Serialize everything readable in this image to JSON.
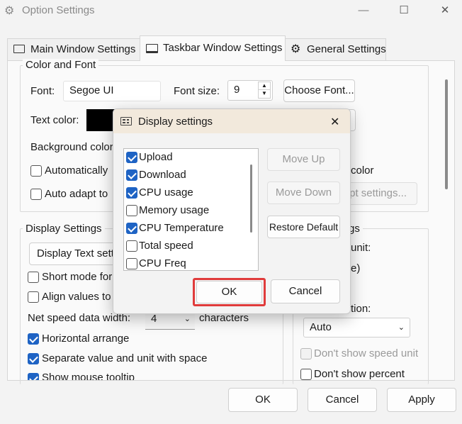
{
  "window": {
    "title": "Option Settings",
    "icon": "gear-icon",
    "minimize": "—",
    "maximize": "☐",
    "close": "✕"
  },
  "tabs": [
    {
      "label": "Main Window Settings",
      "icon": "monitor-icon"
    },
    {
      "label": "Taskbar Window Settings",
      "icon": "taskbar-icon",
      "active": true
    },
    {
      "label": "General Settings",
      "icon": "gear-icon"
    }
  ],
  "color_font": {
    "group_label": "Color and Font",
    "font_label": "Font:",
    "font_value": "Segoe UI",
    "font_size_label": "Font size:",
    "font_size_value": "9",
    "choose_font": "Choose Font...",
    "text_color_label": "Text color:",
    "text_color": "#000000",
    "background_color_label": "Background color",
    "auto_label": "Automatically",
    "auto_adapt_label": "Auto adapt to",
    "color_suffix": "color",
    "adapt_settings": "pt settings..."
  },
  "display_settings": {
    "group_label": "Display Settings",
    "display_text_button": "Display Text setti",
    "short_mode": "Short mode for",
    "align_values": "Align values to",
    "net_speed_label": "Net speed data width:",
    "net_speed_value": "4",
    "characters": "characters",
    "horizontal_arrange": "Horizontal arrange",
    "separate_value": "Separate value and unit with space",
    "show_tooltip": "Show mouse tooltip"
  },
  "right_group": {
    "group_label": "gs",
    "unit_label": "unit:",
    "e_label": "e)",
    "tion_label": "tion:",
    "auto_value": "Auto",
    "dont_show_speed_unit": "Don't show speed unit",
    "dont_show_percent": "Don't show percent"
  },
  "dialog": {
    "title": "Display settings",
    "icon": "display-settings-icon",
    "close": "✕",
    "items": [
      {
        "label": "Upload",
        "checked": true
      },
      {
        "label": "Download",
        "checked": true
      },
      {
        "label": "CPU usage",
        "checked": true
      },
      {
        "label": "Memory usage",
        "checked": false
      },
      {
        "label": "CPU Temperature",
        "checked": true
      },
      {
        "label": "Total speed",
        "checked": false
      },
      {
        "label": "CPU Freq",
        "checked": false
      }
    ],
    "move_up": "Move Up",
    "move_down": "Move Down",
    "restore_default": "Restore Default",
    "ok": "OK",
    "cancel": "Cancel"
  },
  "bottom": {
    "ok": "OK",
    "cancel": "Cancel",
    "apply": "Apply"
  }
}
